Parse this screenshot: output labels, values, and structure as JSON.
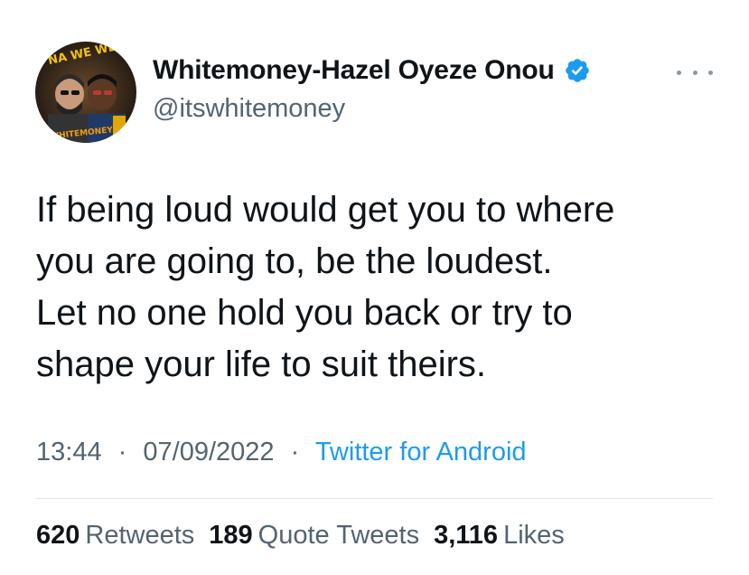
{
  "author": {
    "display_name": "Whitemoney-Hazel Oyeze Onou",
    "handle": "@itswhitemoney",
    "verified": true,
    "avatar_text_top": "NA WE WE",
    "avatar_text_bottom": "WHITEMONEY ZOR"
  },
  "tweet": {
    "text": "If being loud would get you to where\nyou are going to, be the loudest.\nLet no one hold you back or try to\nshape your life to suit theirs."
  },
  "meta": {
    "time": "13:44",
    "separator": "·",
    "date": "07/09/2022",
    "source": "Twitter for Android"
  },
  "stats": {
    "retweets_count": "620",
    "retweets_label": "Retweets",
    "quotes_count": "189",
    "quotes_label": "Quote Tweets",
    "likes_count": "3,116",
    "likes_label": "Likes"
  },
  "colors": {
    "accent": "#1d9bf0",
    "secondary_text": "#536471",
    "primary_text": "#0f1419",
    "divider": "#dfe4e8"
  },
  "icons": {
    "verified": "verified-badge-icon",
    "more": "more-options-icon"
  }
}
